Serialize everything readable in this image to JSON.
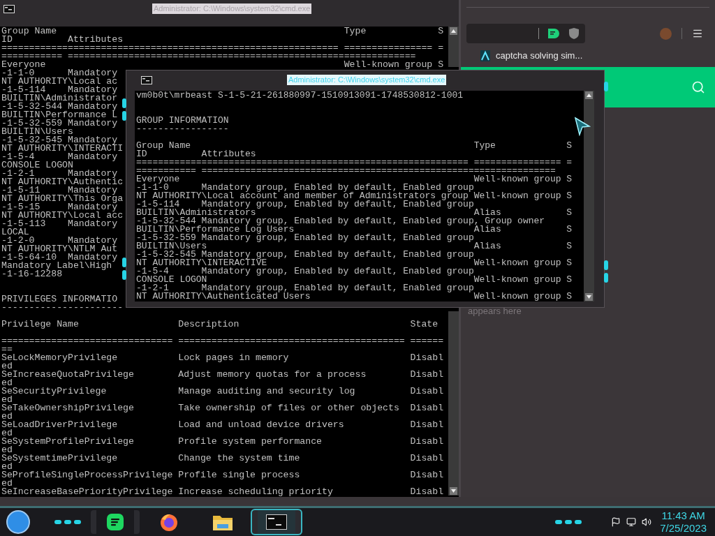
{
  "back_window": {
    "title": "Administrator: C:\\Windows\\system32\\cmd.exe",
    "lines": [
      {
        "kind": "group",
        "name": "Group Name",
        "type": "Type",
        "s": "S"
      },
      {
        "kind": "attr",
        "id": "ID",
        "attributes": "Attributes"
      },
      {
        "kind": "text",
        "text": "============================================================= ================ ="
      },
      {
        "kind": "text",
        "text": "=========== ==============================================================="
      },
      {
        "kind": "group",
        "name": "Everyone",
        "type": "Well-known group",
        "s": "S"
      },
      {
        "kind": "text",
        "text": "-1-1-0      Mandatory"
      },
      {
        "kind": "text",
        "text": "NT AUTHORITY\\Local ac"
      },
      {
        "kind": "text",
        "text": "-1-5-114    Mandatory"
      },
      {
        "kind": "text",
        "text": "BUILTIN\\Administrator"
      },
      {
        "kind": "text",
        "text": "-1-5-32-544 Mandatory"
      },
      {
        "kind": "text",
        "text": "BUILTIN\\Performance L"
      },
      {
        "kind": "text",
        "text": "-1-5-32-559 Mandatory"
      },
      {
        "kind": "text",
        "text": "BUILTIN\\Users"
      },
      {
        "kind": "text",
        "text": "-1-5-32-545 Mandatory"
      },
      {
        "kind": "text",
        "text": "NT AUTHORITY\\INTERACTI"
      },
      {
        "kind": "text",
        "text": "-1-5-4      Mandatory"
      },
      {
        "kind": "text",
        "text": "CONSOLE LOGON"
      },
      {
        "kind": "text",
        "text": "-1-2-1      Mandatory"
      },
      {
        "kind": "text",
        "text": "NT AUTHORITY\\Authentic"
      },
      {
        "kind": "text",
        "text": "-1-5-11     Mandatory"
      },
      {
        "kind": "text",
        "text": "NT AUTHORITY\\This Orga"
      },
      {
        "kind": "text",
        "text": "-1-5-15     Mandatory"
      },
      {
        "kind": "text",
        "text": "NT AUTHORITY\\Local acc"
      },
      {
        "kind": "text",
        "text": "-1-5-113    Mandatory"
      },
      {
        "kind": "text",
        "text": "LOCAL"
      },
      {
        "kind": "text",
        "text": "-1-2-0      Mandatory"
      },
      {
        "kind": "text",
        "text": "NT AUTHORITY\\NTLM Aut"
      },
      {
        "kind": "text",
        "text": "-1-5-64-10  Mandatory"
      },
      {
        "kind": "text",
        "text": "Mandatory Label\\High"
      },
      {
        "kind": "text",
        "text": "-1-16-12288"
      },
      {
        "kind": "blank"
      },
      {
        "kind": "blank"
      },
      {
        "kind": "text",
        "text": "PRIVILEGES INFORMATIO"
      },
      {
        "kind": "text",
        "text": "----------------------"
      },
      {
        "kind": "blank"
      },
      {
        "kind": "priv",
        "name": "Privilege Name",
        "description": "Description",
        "state": "State"
      },
      {
        "kind": "blank"
      },
      {
        "kind": "text",
        "text": "=============================== ========================================= ========"
      },
      {
        "kind": "priv",
        "name": "SeLockMemoryPrivilege",
        "description": "Lock pages in memory",
        "state": "Disabled"
      },
      {
        "kind": "priv",
        "name": "SeIncreaseQuotaPrivilege",
        "description": "Adjust memory quotas for a process",
        "state": "Disabled"
      },
      {
        "kind": "priv",
        "name": "SeSecurityPrivilege",
        "description": "Manage auditing and security log",
        "state": "Disabled"
      },
      {
        "kind": "priv",
        "name": "SeTakeOwnershipPrivilege",
        "description": "Take ownership of files or other objects",
        "state": "Disabled"
      },
      {
        "kind": "priv",
        "name": "SeLoadDriverPrivilege",
        "description": "Load and unload device drivers",
        "state": "Disabled"
      },
      {
        "kind": "priv",
        "name": "SeSystemProfilePrivilege",
        "description": "Profile system performance",
        "state": "Disabled"
      },
      {
        "kind": "priv",
        "name": "SeSystemtimePrivilege",
        "description": "Change the system time",
        "state": "Disabled"
      },
      {
        "kind": "priv",
        "name": "SeProfileSingleProcessPrivilege",
        "description": "Profile single process",
        "state": "Disabled"
      },
      {
        "kind": "priv",
        "name": "SeIncreaseBasePriorityPrivilege",
        "description": "Increase scheduling priority",
        "state": "Disabl"
      }
    ]
  },
  "front_window": {
    "title": "Administrator: C:\\Windows\\system32\\cmd.exe",
    "lines": [
      {
        "kind": "text",
        "text": "vm0b0t\\mrbeast S-1-5-21-261880997-1510913091-1748530812-1001"
      },
      {
        "kind": "blank"
      },
      {
        "kind": "blank"
      },
      {
        "kind": "text",
        "text": "GROUP INFORMATION"
      },
      {
        "kind": "text",
        "text": "-----------------"
      },
      {
        "kind": "blank"
      },
      {
        "kind": "group",
        "name": "Group Name",
        "type": "Type",
        "s": "S"
      },
      {
        "kind": "attr",
        "id": "ID",
        "attributes": "Attributes"
      },
      {
        "kind": "text",
        "text": "============================================================= ================ ="
      },
      {
        "kind": "text",
        "text": "=========== ================================================================="
      },
      {
        "kind": "group",
        "name": "Everyone",
        "type": "Well-known group",
        "s": "S"
      },
      {
        "kind": "attr",
        "id": "-1-1-0",
        "attributes": "Mandatory group, Enabled by default, Enabled group"
      },
      {
        "kind": "group",
        "name": "NT AUTHORITY\\Local account and member of Administrators group",
        "type": "Well-known group",
        "s": "S"
      },
      {
        "kind": "attr",
        "id": "-1-5-114",
        "attributes": "Mandatory group, Enabled by default, Enabled group"
      },
      {
        "kind": "group",
        "name": "BUILTIN\\Administrators",
        "type": "Alias",
        "s": "S"
      },
      {
        "kind": "attr",
        "id": "-1-5-32-544",
        "attributes": "Mandatory group, Enabled by default, Enabled group, Group owner"
      },
      {
        "kind": "group",
        "name": "BUILTIN\\Performance Log Users",
        "type": "Alias",
        "s": "S"
      },
      {
        "kind": "attr",
        "id": "-1-5-32-559",
        "attributes": "Mandatory group, Enabled by default, Enabled group"
      },
      {
        "kind": "group",
        "name": "BUILTIN\\Users",
        "type": "Alias",
        "s": "S"
      },
      {
        "kind": "attr",
        "id": "-1-5-32-545",
        "attributes": "Mandatory group, Enabled by default, Enabled group"
      },
      {
        "kind": "group",
        "name": "NT AUTHORITY\\INTERACTIVE",
        "type": "Well-known group",
        "s": "S"
      },
      {
        "kind": "attr",
        "id": "-1-5-4",
        "attributes": "Mandatory group, Enabled by default, Enabled group"
      },
      {
        "kind": "group",
        "name": "CONSOLE LOGON",
        "type": "Well-known group",
        "s": "S"
      },
      {
        "kind": "attr",
        "id": "-1-2-1",
        "attributes": "Mandatory group, Enabled by default, Enabled group"
      },
      {
        "kind": "group",
        "name": "NT AUTHORITY\\Authenticated Users",
        "type": "Well-known group",
        "s": "S"
      }
    ]
  },
  "browser": {
    "bookmark": "captcha solving sim...",
    "panel_text": "appears here"
  },
  "taskbar": {
    "apps": [
      {
        "kind": "music",
        "running": true,
        "selected": false
      },
      {
        "kind": "browser",
        "running": false,
        "selected": false
      },
      {
        "kind": "folder",
        "running": false,
        "selected": false
      },
      {
        "kind": "terminal",
        "running": true,
        "selected": true
      }
    ],
    "time": "11:43 AM",
    "date": "7/25/2023"
  }
}
